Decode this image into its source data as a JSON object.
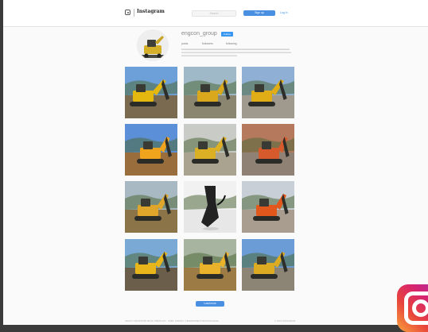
{
  "navbar": {
    "logo_icon": "camera-icon",
    "wordmark": "Instagram",
    "search_placeholder": "Search",
    "signup_button": "Sign up",
    "login_link": "Log in"
  },
  "profile": {
    "username": "engcon_group",
    "follow_button": "Follow",
    "stats": [
      "posts",
      "followers",
      "following"
    ],
    "bio_lines": [
      "",
      "",
      ""
    ]
  },
  "posts": [
    {
      "name": "tiltrotator-excavator-post",
      "sky": "#6d9fd8",
      "ground": "#7a6a50",
      "machine": "#e5b80f"
    },
    {
      "name": "roadside-excavator-post",
      "sky": "#9fb9c9",
      "ground": "#8b8670",
      "machine": "#d9a81c"
    },
    {
      "name": "compactor-plate-post",
      "sky": "#8fb0d4",
      "ground": "#a09a8e",
      "machine": "#e0ad17"
    },
    {
      "name": "excavator-at-river-post",
      "sky": "#5b8fd8",
      "ground": "#9a6e3c",
      "machine": "#f0a41e"
    },
    {
      "name": "excavator-arm-post",
      "sky": "#c9cbc7",
      "ground": "#a9a38f",
      "machine": "#dcb025"
    },
    {
      "name": "grab-attachment-post",
      "sky": "#b5795d",
      "ground": "#8f8275",
      "machine": "#d65a2b"
    },
    {
      "name": "trench-work-post",
      "sky": "#a8b9c4",
      "ground": "#8a7448",
      "machine": "#e0a62c"
    },
    {
      "name": "quick-coupler-post",
      "sky": "#f1f1f1",
      "ground": "#e7e7e7",
      "machine": "#222222"
    },
    {
      "name": "orange-excavator-post",
      "sky": "#c8cfd6",
      "ground": "#a89d8f",
      "machine": "#e2571b"
    },
    {
      "name": "hillside-excavator-post",
      "sky": "#7aa9d6",
      "ground": "#6b5e4b",
      "machine": "#e8b61a"
    },
    {
      "name": "ditch-digging-post",
      "sky": "#a7b4a0",
      "ground": "#9d7b45",
      "machine": "#e9b22a"
    },
    {
      "name": "rock-breaking-post",
      "sky": "#6c9cd6",
      "ground": "#8c8576",
      "machine": "#dcab22"
    }
  ],
  "load_more_button": "Load more",
  "footer": {
    "links": [
      "ABOUT US",
      "SUPPORT",
      "BLOG",
      "PRESS",
      "API",
      "JOBS",
      "PRIVACY",
      "TERMS",
      "DIRECTORY",
      "LANGUAGE"
    ],
    "copyright": "© 2016 INSTAGRAM"
  },
  "overlay_logo": "instagram-logo-icon"
}
